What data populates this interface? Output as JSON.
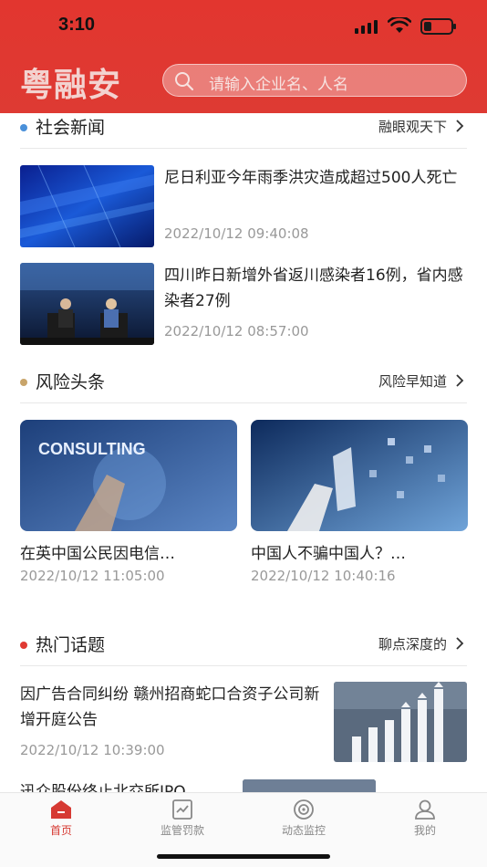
{
  "status_bar": {
    "time": "3:10"
  },
  "header": {
    "logo": "粤融安",
    "search_placeholder": "请输入企业名、人名"
  },
  "sections": {
    "social_news": {
      "title": "社会新闻",
      "more": "融眼观天下",
      "dot_color": "#4a90d9",
      "items": [
        {
          "title": "尼日利亚今年雨季洪灾造成超过500人死亡",
          "time": "2022/10/12 09:40:08"
        },
        {
          "title": "四川昨日新增外省返川感染者16例，省内感染者27例",
          "time": "2022/10/12 08:57:00"
        }
      ]
    },
    "risk_headlines": {
      "title": "风险头条",
      "more": "风险早知道",
      "dot_color": "#c8a46a",
      "items": [
        {
          "title": "在英中国公民因电信…",
          "time": "2022/10/12 11:05:00",
          "image_text": "CONSULTING"
        },
        {
          "title": "中国人不骗中国人？…",
          "time": "2022/10/12 10:40:16"
        }
      ]
    },
    "hot_topics": {
      "title": "热门话题",
      "more": "聊点深度的",
      "dot_color": "#e03a33",
      "items": [
        {
          "title": "因广告合同纠纷 赣州招商蛇口合资子公司新增开庭公告",
          "time": "2022/10/12 10:39:00"
        },
        {
          "title": "迅众股份终止北交所IPO",
          "time": ""
        }
      ]
    }
  },
  "tabbar": {
    "tabs": [
      {
        "label": "首页",
        "icon": "home-icon",
        "active": true
      },
      {
        "label": "监管罚款",
        "icon": "regulation-icon",
        "active": false
      },
      {
        "label": "动态监控",
        "icon": "monitor-icon",
        "active": false
      },
      {
        "label": "我的",
        "icon": "profile-icon",
        "active": false
      }
    ]
  },
  "colors": {
    "brand": "#e2362f",
    "accent_active": "#d63a33"
  }
}
